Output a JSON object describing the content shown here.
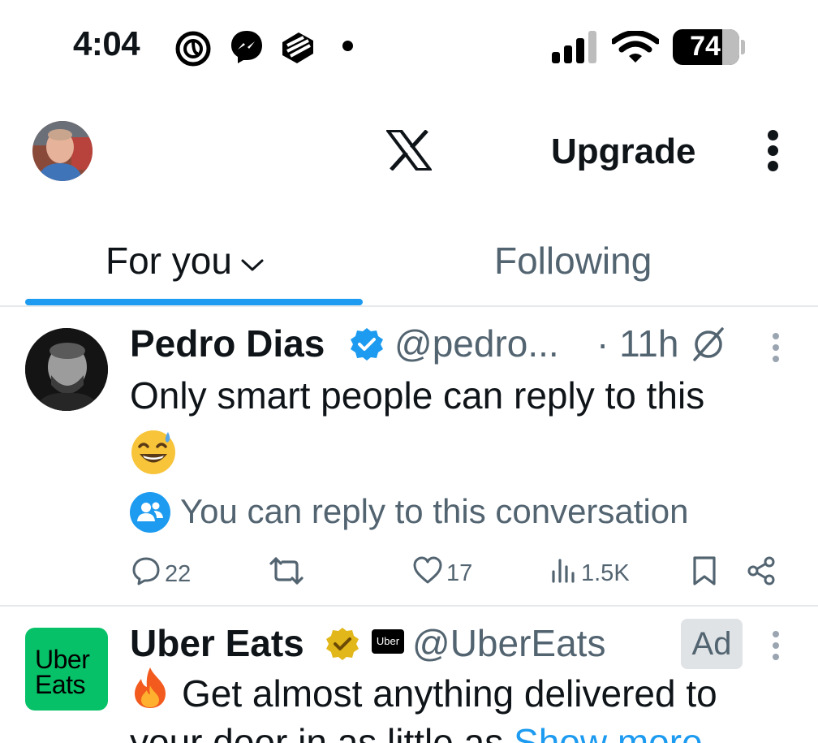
{
  "status_bar": {
    "time": "4:04",
    "battery": "74",
    "battery_fraction": 0.74,
    "icons": [
      "threads-icon",
      "messenger-icon",
      "app-icon",
      "notification-dot",
      "cell-signal-icon",
      "wifi-icon",
      "battery-icon"
    ]
  },
  "header": {
    "upgrade_label": "Upgrade",
    "logo": "x-logo-icon",
    "avatar": "profile-avatar",
    "more": "more-vertical-icon"
  },
  "tabs": [
    {
      "label": "For you",
      "active": true
    },
    {
      "label": "Following",
      "active": false
    }
  ],
  "colors": {
    "accent": "#1d9bf0",
    "secondary_text": "#536471",
    "divider": "#e6e9ec",
    "uber_green": "#06c167",
    "gold_badge": "#e2b719"
  },
  "posts": [
    {
      "name": "Pedro Dias",
      "handle": "@pedro...",
      "time": "· 11h",
      "text": "Only smart people can reply to this",
      "emoji": "😅",
      "reply_notice": "You can reply to this conversation",
      "stats": {
        "replies": "22",
        "likes": "17",
        "views": "1.5K"
      }
    },
    {
      "name": "Uber Eats",
      "logo_text_1": "Uber",
      "logo_text_2": "Eats",
      "affiliate_badge": "Uber",
      "handle": "@UberEats",
      "ad_label": "Ad",
      "emoji": "🔥",
      "text_line1": "Get almost anything delivered to",
      "text_line2": "your door in as little as ",
      "show_more": "Show more"
    }
  ]
}
